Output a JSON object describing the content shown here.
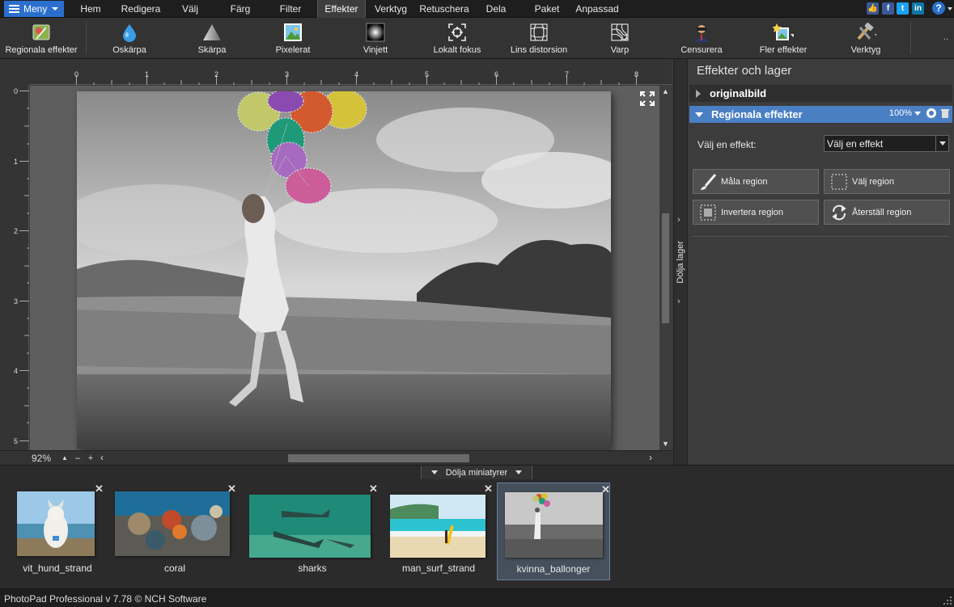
{
  "menubar": {
    "menu_label": "Meny",
    "tabs": [
      "Hem",
      "Redigera",
      "Välj",
      "Färg",
      "Filter",
      "Effekter",
      "Verktyg",
      "Retuschera",
      "Dela",
      "Paket",
      "Anpassad"
    ],
    "active_tab": "Effekter",
    "social": [
      "like-icon",
      "facebook-icon",
      "twitter-icon",
      "linkedin-icon"
    ],
    "help_label": "?"
  },
  "toolbar": {
    "tools": [
      {
        "label": "Regionala effekter",
        "icon": "regional-effects-icon"
      },
      {
        "label": "Oskärpa",
        "icon": "blur-drop-icon"
      },
      {
        "label": "Skärpa",
        "icon": "sharpen-icon"
      },
      {
        "label": "Pixelerat",
        "icon": "pixelate-icon"
      },
      {
        "label": "Vinjett",
        "icon": "vignette-icon"
      },
      {
        "label": "Lokalt fokus",
        "icon": "local-focus-icon"
      },
      {
        "label": "Lins distorsion",
        "icon": "lens-distortion-icon"
      },
      {
        "label": "Varp",
        "icon": "warp-icon"
      },
      {
        "label": "Censurera",
        "icon": "censor-icon"
      },
      {
        "label": "Fler effekter",
        "icon": "more-effects-icon"
      },
      {
        "label": "Verktyg",
        "icon": "tools-icon"
      }
    ],
    "more": ".."
  },
  "canvas": {
    "ruler_top": [
      "0",
      "1",
      "2",
      "3",
      "4",
      "5",
      "6",
      "7",
      "8"
    ],
    "ruler_left": [
      "0",
      "1",
      "2",
      "3",
      "4",
      "5"
    ],
    "zoom": "92%"
  },
  "side_strip": {
    "label": "Dölja lager"
  },
  "panel": {
    "title": "Effekter och lager",
    "layers": [
      {
        "name": "originalbild"
      },
      {
        "name": "Regionala effekter",
        "opacity": "100%"
      }
    ],
    "effect_label": "Välj en effekt:",
    "effect_value": "Välj en effekt",
    "buttons": {
      "paint": "Måla region",
      "select": "Välj region",
      "invert": "Invertera region",
      "reset": "Återställ region"
    }
  },
  "thumbs": {
    "toggle_label": "Dölja miniatyrer",
    "items": [
      {
        "name": "vit_hund_strand"
      },
      {
        "name": "coral"
      },
      {
        "name": "sharks"
      },
      {
        "name": "man_surf_strand"
      },
      {
        "name": "kvinna_ballonger",
        "selected": true
      }
    ],
    "close": "✕"
  },
  "status": {
    "text": "PhotoPad Professional v 7.78 © NCH Software"
  },
  "colors": {
    "accent": "#2b6fce",
    "layer_selected": "#4a7fc4"
  }
}
